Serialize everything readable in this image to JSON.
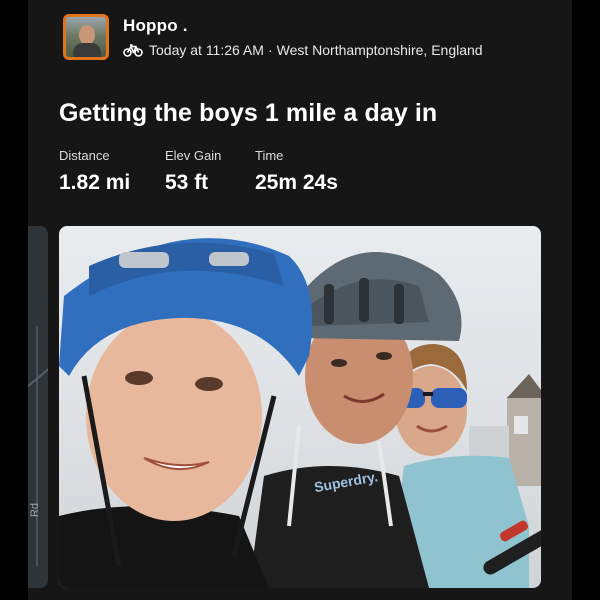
{
  "athlete": {
    "name": "Hoppo .",
    "meta_time": "Today at 11:26 AM",
    "separator": "·",
    "location": "West Northamptonshire, England",
    "activity_icon": "bike-icon"
  },
  "activity": {
    "title": "Getting the boys 1 mile a day in",
    "stats": [
      {
        "label": "Distance",
        "value": "1.82 mi"
      },
      {
        "label": "Elev Gain",
        "value": "53 ft"
      },
      {
        "label": "Time",
        "value": "25m 24s"
      }
    ]
  },
  "map": {
    "road_label": "Rd"
  },
  "photo": {
    "shirt_text": "Superdry."
  },
  "colors": {
    "background": "#000000",
    "card": "#161616",
    "avatar_border": "#e2741d",
    "text_primary": "#ffffff",
    "text_secondary": "#dcdcdc"
  }
}
